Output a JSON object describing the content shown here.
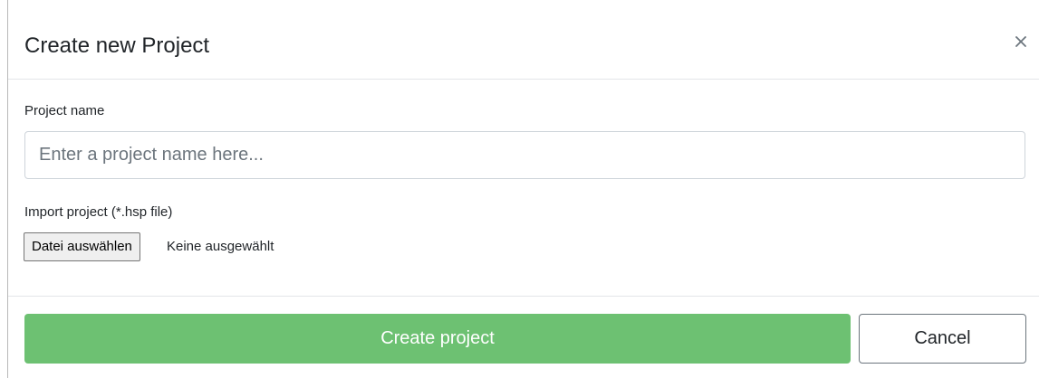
{
  "dialog": {
    "title": "Create new Project",
    "close_icon": "close-icon"
  },
  "project_name": {
    "label": "Project name",
    "placeholder": "Enter a project name here...",
    "value": ""
  },
  "import": {
    "label": "Import project (*.hsp file)",
    "button_label": "Datei auswählen",
    "status": "Keine ausgewählt"
  },
  "footer": {
    "create_label": "Create project",
    "cancel_label": "Cancel"
  },
  "colors": {
    "primary": "#6dc172",
    "border": "#ced4da",
    "text": "#212529"
  }
}
